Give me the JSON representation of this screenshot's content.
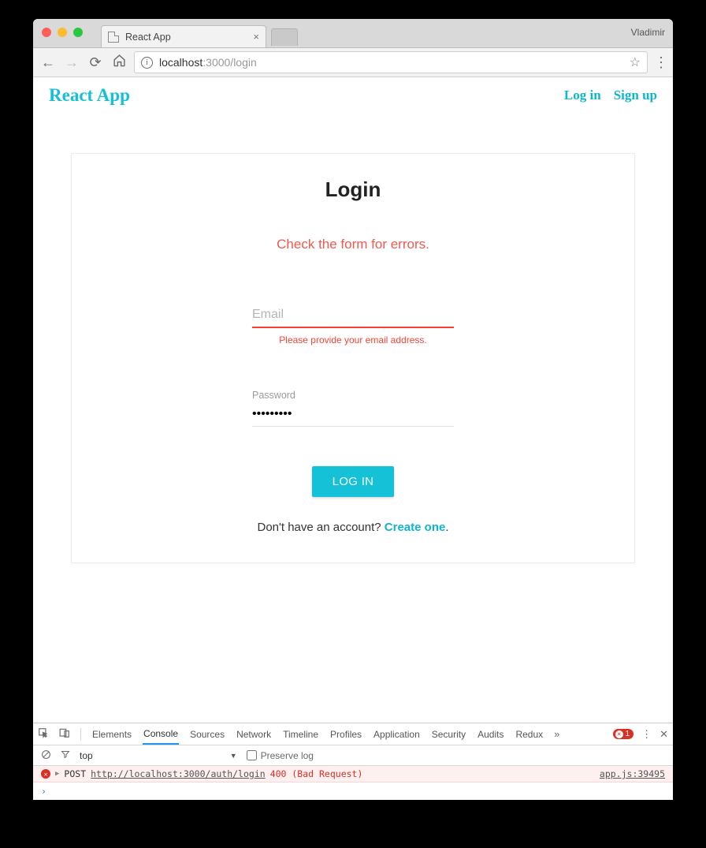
{
  "browser": {
    "profile": "Vladimir",
    "tab_title": "React App",
    "url_host": "localhost",
    "url_path": ":3000/login"
  },
  "app": {
    "brand": "React App",
    "nav": {
      "login": "Log in",
      "signup": "Sign up"
    }
  },
  "login": {
    "title": "Login",
    "form_error": "Check the form for errors.",
    "email": {
      "placeholder": "Email",
      "value": "",
      "error": "Please provide your email address."
    },
    "password": {
      "label": "Password",
      "value": "•••••••••"
    },
    "submit": "LOG IN",
    "noaccount_prefix": "Don't have an account? ",
    "noaccount_link": "Create one",
    "noaccount_suffix": "."
  },
  "devtools": {
    "tabs": [
      "Elements",
      "Console",
      "Sources",
      "Network",
      "Timeline",
      "Profiles",
      "Application",
      "Security",
      "Audits",
      "Redux"
    ],
    "active_tab": "Console",
    "error_count": "1",
    "context": "top",
    "preserve_log_label": "Preserve log",
    "log": {
      "method": "POST",
      "url": "http://localhost:3000/auth/login",
      "status": "400 (Bad Request)",
      "source": "app.js:39495"
    }
  }
}
